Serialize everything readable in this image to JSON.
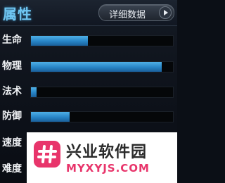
{
  "header": {
    "title": "属性",
    "detail_button_label": "详细数据"
  },
  "stats": [
    {
      "label": "生命",
      "fill": 0.4
    },
    {
      "label": "物理",
      "fill": 0.92
    },
    {
      "label": "法术",
      "fill": 0.04
    },
    {
      "label": "防御",
      "fill": 0.27
    },
    {
      "label": "速度",
      "fill": null
    },
    {
      "label": "难度",
      "fill": null
    }
  ],
  "colors": {
    "title": "#6fc6f2",
    "bar_fill": "#2784c6",
    "watermark_accent": "#e8356b"
  },
  "watermark": {
    "title": "兴业软件园",
    "domain": "MYXYJS.COM",
    "icon": "hash-logo-icon"
  }
}
